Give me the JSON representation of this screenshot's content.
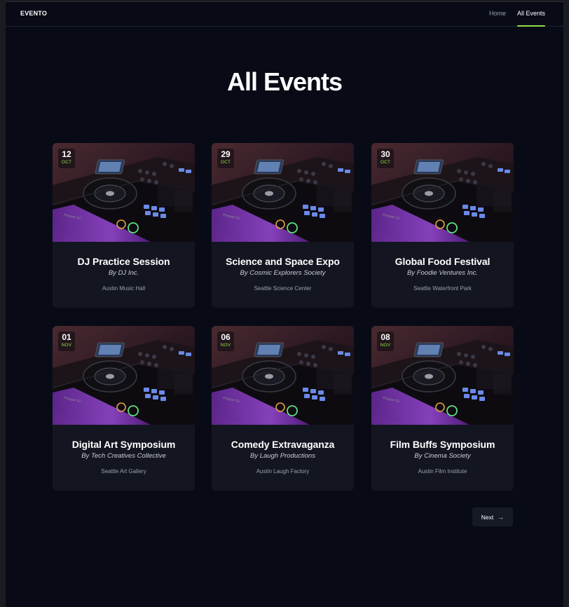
{
  "header": {
    "brand": "EVENTO",
    "nav": [
      {
        "label": "Home",
        "active": false
      },
      {
        "label": "All Events",
        "active": true
      }
    ]
  },
  "main": {
    "title": "All Events",
    "events": [
      {
        "day": "12",
        "month": "OCT",
        "title": "DJ Practice Session",
        "organizer": "By DJ Inc.",
        "venue": "Austin Music Hall",
        "image": "dj-controller-photo"
      },
      {
        "day": "29",
        "month": "OCT",
        "title": "Science and Space Expo",
        "organizer": "By Cosmic Explorers Society",
        "venue": "Seattle Science Center",
        "image": "dj-controller-photo"
      },
      {
        "day": "30",
        "month": "OCT",
        "title": "Global Food Festival",
        "organizer": "By Foodie Ventures Inc.",
        "venue": "Seattle Waterfront Park",
        "image": "dj-controller-photo"
      },
      {
        "day": "01",
        "month": "NOV",
        "title": "Digital Art Symposium",
        "organizer": "By Tech Creatives Collective",
        "venue": "Seattle Art Gallery",
        "image": "dj-controller-photo"
      },
      {
        "day": "06",
        "month": "NOV",
        "title": "Comedy Extravaganza",
        "organizer": "By Laugh Productions",
        "venue": "Austin Laugh Factory",
        "image": "dj-controller-photo"
      },
      {
        "day": "08",
        "month": "NOV",
        "title": "Film Buffs Symposium",
        "organizer": "By Cinema Society",
        "venue": "Austin Film Institute",
        "image": "dj-controller-photo"
      }
    ]
  },
  "pagination": {
    "next_label": "Next",
    "next_icon": "arrow-right-icon"
  },
  "colors": {
    "background": "#080b16",
    "card": "#131620",
    "accent": "#8fe04a"
  }
}
